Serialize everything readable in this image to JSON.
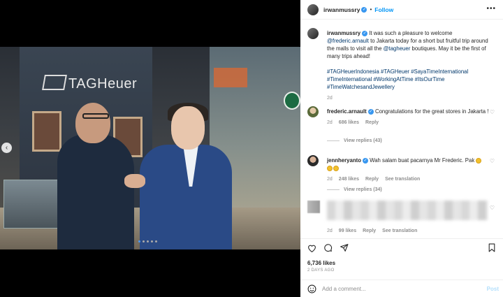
{
  "post": {
    "username": "irwanmussry",
    "follow_label": "Follow",
    "more_label": "•••",
    "separator": "•"
  },
  "caption": {
    "username": "irwanmussry",
    "text_1": " It was such a pleasure to welcome ",
    "mention_1": "@frederic.arnault",
    "text_2": " to Jakarta today for a short but fruitful trip around the malls to visit all the ",
    "mention_2": "@tagheuer",
    "text_3": " boutiques. May it be the first of many trips ahead!",
    "hashtags": "#TAGHeuerIndonesia #TAGHeuer #SayaTimeInternational #TimeInternational #WorkingAtTime #ItsOurTime #TimeWatchesandJewellery",
    "time": "2d"
  },
  "comments": [
    {
      "username": "frederic.arnault",
      "text": "Congratulations for the great stores in Jakarta !",
      "time": "2d",
      "likes": "686 likes",
      "reply_label": "Reply",
      "view_replies": "View replies (43)"
    },
    {
      "username": "jennheryanto",
      "text": "Wah salam buat pacarnya Mr Frederic. Pak",
      "time": "2d",
      "likes": "248 likes",
      "reply_label": "Reply",
      "see_translation": "See translation",
      "view_replies": "View replies (34)"
    },
    {
      "time": "2d",
      "likes": "99 likes",
      "reply_label": "Reply",
      "see_translation": "See translation"
    }
  ],
  "photo": {
    "store_sign": "TAGHeuer",
    "starbucks": "",
    "nav_prev": "‹"
  },
  "footer": {
    "likes": "6,736 likes",
    "ago": "2 DAYS AGO",
    "add_placeholder": "Add a comment...",
    "post_label": "Post"
  },
  "colors": {
    "accent": "#0095f6",
    "link": "#00376b",
    "muted": "#8e8e8e"
  },
  "icons": [
    "heart-icon",
    "comment-icon",
    "share-icon",
    "bookmark-icon",
    "emoji-icon",
    "verified-icon",
    "chevron-left-icon"
  ]
}
